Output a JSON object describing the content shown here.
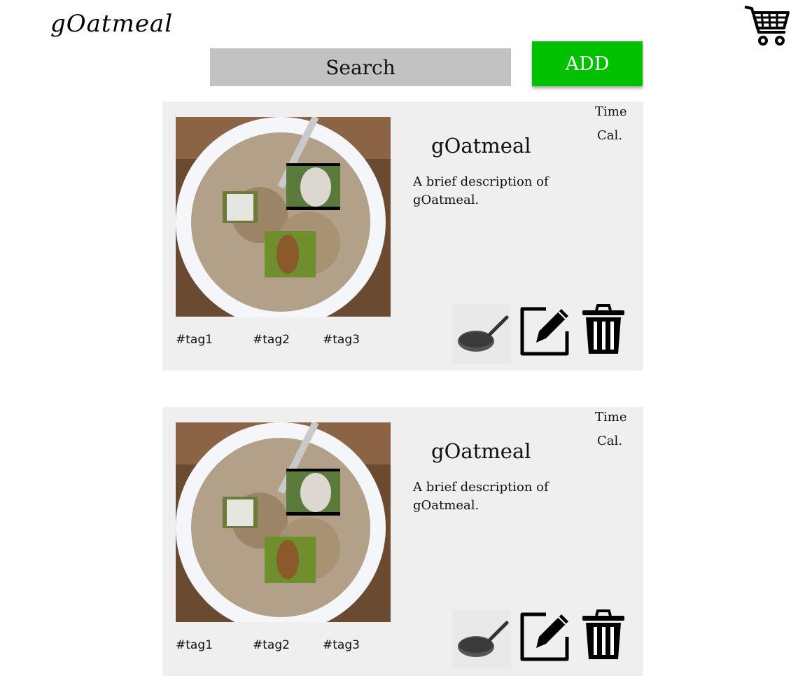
{
  "header": {
    "logo_text": "gOatmeal",
    "search_placeholder": "Search",
    "add_label": "ADD"
  },
  "colors": {
    "add_button": "#00c000",
    "search_bg": "#c2c2c2",
    "card_bg": "#efefef"
  },
  "icons": {
    "cart": "shopping-cart-icon",
    "cook": "frying-pan-icon",
    "edit": "edit-pencil-icon",
    "delete": "trash-icon"
  },
  "recipes": [
    {
      "title": "gOatmeal",
      "description": "A brief description of gOatmeal.",
      "time_label": "Time",
      "cal_label": "Cal.",
      "tags": [
        "#tag1",
        "#tag2",
        "#tag3"
      ]
    },
    {
      "title": "gOatmeal",
      "description": "A brief description of gOatmeal.",
      "time_label": "Time",
      "cal_label": "Cal.",
      "tags": [
        "#tag1",
        "#tag2",
        "#tag3"
      ]
    }
  ]
}
